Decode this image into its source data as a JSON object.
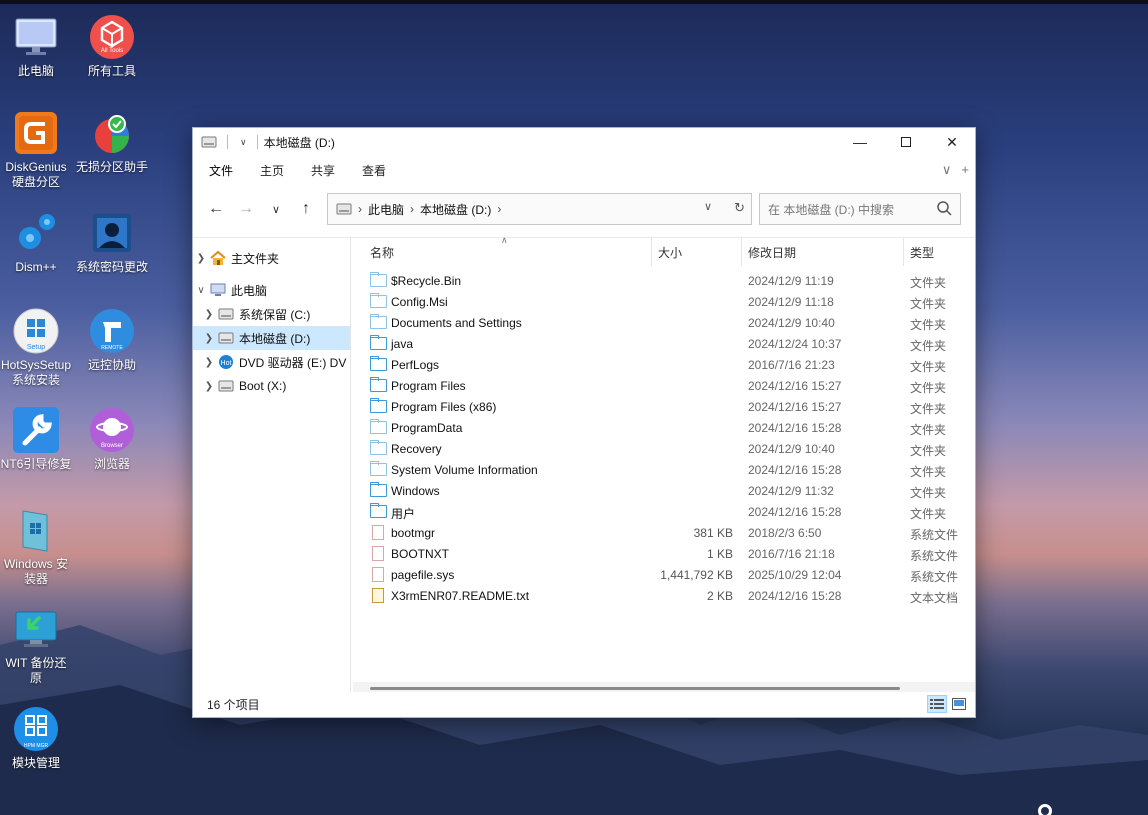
{
  "desktop": {
    "icons": [
      {
        "label": "此电脑",
        "icon": "computer-icon"
      },
      {
        "label": "所有工具",
        "icon": "all-tools-icon",
        "badge": "All Tools"
      },
      {
        "label": "DiskGenius\n硬盘分区",
        "icon": "diskgenius-icon"
      },
      {
        "label": "无损分区助手",
        "icon": "partition-assistant-icon"
      },
      {
        "label": "Dism++",
        "icon": "dism-gears-icon"
      },
      {
        "label": "系统密码更改",
        "icon": "password-change-icon"
      },
      {
        "label": "HotSysSetup\n系统安装",
        "icon": "hotsyssetup-icon",
        "badge": "Setup"
      },
      {
        "label": "远控协助",
        "icon": "remote-icon",
        "badge": "REMOTE"
      },
      {
        "label": "NT6引导修复",
        "icon": "wrench-icon"
      },
      {
        "label": "浏览器",
        "icon": "browser-icon",
        "badge": "Browser"
      },
      {
        "label": "Windows 安\n装器",
        "icon": "windows-installer-icon"
      },
      {
        "label": "WIT 备份还\n原",
        "icon": "backup-restore-icon"
      },
      {
        "label": "模块管理",
        "icon": "module-manager-icon",
        "badge": "HPM MGR"
      }
    ]
  },
  "window": {
    "title": "本地磁盘 (D:)",
    "ribbon_tabs": [
      "文件",
      "主页",
      "共享",
      "查看"
    ],
    "address": {
      "crumbs": [
        "此电脑",
        "本地磁盘 (D:)"
      ]
    },
    "search": {
      "placeholder": "在 本地磁盘 (D:) 中搜索"
    },
    "nav": [
      {
        "label": "主文件夹",
        "icon": "home-icon"
      },
      {
        "label": "此电脑",
        "icon": "computer-icon"
      },
      {
        "label": "系统保留 (C:)",
        "icon": "drive-icon"
      },
      {
        "label": "本地磁盘 (D:)",
        "icon": "drive-icon"
      },
      {
        "label": "DVD 驱动器 (E:) DV",
        "icon": "dvd-icon"
      },
      {
        "label": "Boot (X:)",
        "icon": "drive-icon"
      }
    ],
    "columns": {
      "name": "名称",
      "size": "大小",
      "date": "修改日期",
      "type": "类型"
    },
    "files": [
      {
        "name": "$Recycle.Bin",
        "size": "",
        "date": "2024/12/9 11:19",
        "type": "文件夹",
        "kind": "folder-light"
      },
      {
        "name": "Config.Msi",
        "size": "",
        "date": "2024/12/9 11:18",
        "type": "文件夹",
        "kind": "folder-light"
      },
      {
        "name": "Documents and Settings",
        "size": "",
        "date": "2024/12/9 10:40",
        "type": "文件夹",
        "kind": "folder-light"
      },
      {
        "name": "java",
        "size": "",
        "date": "2024/12/24 10:37",
        "type": "文件夹",
        "kind": "folder"
      },
      {
        "name": "PerfLogs",
        "size": "",
        "date": "2016/7/16 21:23",
        "type": "文件夹",
        "kind": "folder"
      },
      {
        "name": "Program Files",
        "size": "",
        "date": "2024/12/16 15:27",
        "type": "文件夹",
        "kind": "folder"
      },
      {
        "name": "Program Files (x86)",
        "size": "",
        "date": "2024/12/16 15:27",
        "type": "文件夹",
        "kind": "folder"
      },
      {
        "name": "ProgramData",
        "size": "",
        "date": "2024/12/16 15:28",
        "type": "文件夹",
        "kind": "folder-light"
      },
      {
        "name": "Recovery",
        "size": "",
        "date": "2024/12/9 10:40",
        "type": "文件夹",
        "kind": "folder-light"
      },
      {
        "name": "System Volume Information",
        "size": "",
        "date": "2024/12/16 15:28",
        "type": "文件夹",
        "kind": "folder-light"
      },
      {
        "name": "Windows",
        "size": "",
        "date": "2024/12/9 11:32",
        "type": "文件夹",
        "kind": "folder"
      },
      {
        "name": "用户",
        "size": "",
        "date": "2024/12/16 15:28",
        "type": "文件夹",
        "kind": "folder"
      },
      {
        "name": "bootmgr",
        "size": "381 KB",
        "date": "2018/2/3 6:50",
        "type": "系统文件",
        "kind": "sys"
      },
      {
        "name": "BOOTNXT",
        "size": "1 KB",
        "date": "2016/7/16 21:18",
        "type": "系统文件",
        "kind": "sys"
      },
      {
        "name": "pagefile.sys",
        "size": "1,441,792 KB",
        "date": "2025/10/29 12:04",
        "type": "系统文件",
        "kind": "sys"
      },
      {
        "name": "X3rmENR07.README.txt",
        "size": "2 KB",
        "date": "2024/12/16 15:28",
        "type": "文本文档",
        "kind": "txt"
      }
    ],
    "status": "16 个项目"
  }
}
